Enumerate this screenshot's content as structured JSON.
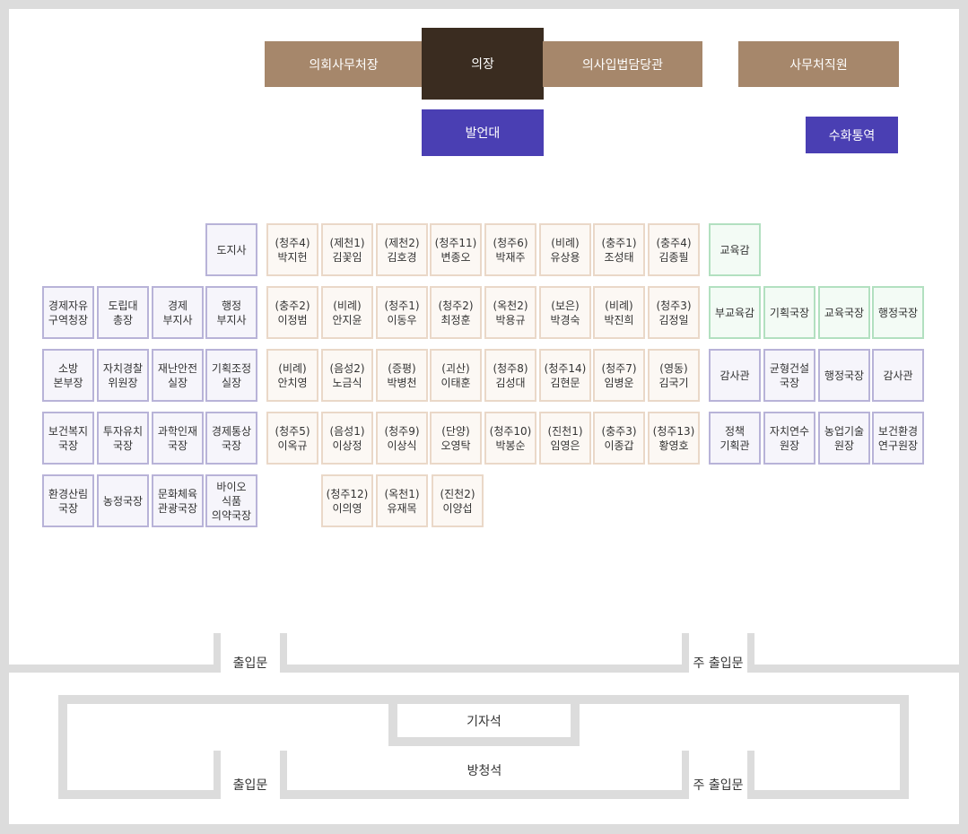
{
  "header": {
    "secretary_general": "의회사무처장",
    "chairman": "의장",
    "legislative_officer": "의사입법담당관",
    "staff": "사무처직원",
    "podium": "발언대",
    "sign_language": "수화통역"
  },
  "executive": {
    "governor": "도지사",
    "row2": [
      "경제자유\n구역청장",
      "도립대\n총장",
      "경제\n부지사",
      "행정\n부지사"
    ],
    "row3": [
      "소방\n본부장",
      "자치경찰\n위원장",
      "재난안전\n실장",
      "기획조정\n실장"
    ],
    "row4": [
      "보건복지\n국장",
      "투자유치\n국장",
      "과학인재\n국장",
      "경제통상\n국장"
    ],
    "row5": [
      "환경산림\n국장",
      "농정국장",
      "문화체육\n관광국장",
      "바이오\n식품\n의약국장"
    ]
  },
  "members": {
    "row1": [
      "(청주4)\n박지헌",
      "(제천1)\n김꽃임",
      "(제천2)\n김호경",
      "(청주11)\n변종오",
      "(청주6)\n박재주",
      "(비례)\n유상용",
      "(충주1)\n조성태",
      "(충주4)\n김종필"
    ],
    "row2": [
      "(충주2)\n이정범",
      "(비례)\n안지윤",
      "(청주1)\n이동우",
      "(청주2)\n최정훈",
      "(옥천2)\n박용규",
      "(보은)\n박경숙",
      "(비례)\n박진희",
      "(청주3)\n김정일"
    ],
    "row3": [
      "(비례)\n안치영",
      "(음성2)\n노금식",
      "(증평)\n박병천",
      "(괴산)\n이태훈",
      "(청주8)\n김성대",
      "(청주14)\n김현문",
      "(청주7)\n임병운",
      "(영동)\n김국기"
    ],
    "row4": [
      "(청주5)\n이옥규",
      "(음성1)\n이상정",
      "(청주9)\n이상식",
      "(단양)\n오영탁",
      "(청주10)\n박봉순",
      "(진천1)\n임영은",
      "(충주3)\n이종갑",
      "(청주13)\n황영호"
    ],
    "row5": [
      "(청주12)\n이의영",
      "(옥천1)\n유재목",
      "(진천2)\n이양섭"
    ]
  },
  "education": {
    "superintendent": "교육감",
    "row2": [
      "부교육감",
      "기획국장",
      "교육국장",
      "행정국장"
    ],
    "row3": [
      "감사관",
      "균형건설\n국장",
      "행정국장",
      "감사관"
    ],
    "row4": [
      "정책\n기획관",
      "자치연수\n원장",
      "농업기술\n원장",
      "보건환경\n연구원장"
    ]
  },
  "hall": {
    "entrance_left": "출입문",
    "entrance_main": "주 출입문",
    "press": "기자석",
    "gallery": "방청석",
    "gallery_entrance_left": "출입문",
    "gallery_entrance_main": "주 출입문"
  },
  "colors": {
    "brown": "#a6876b",
    "dark_brown": "#3a2c20",
    "purple": "#4a3fb3",
    "exec_border": "#b8b3d8",
    "member_border": "#ead8c8",
    "edu_border": "#b2e0c0"
  }
}
